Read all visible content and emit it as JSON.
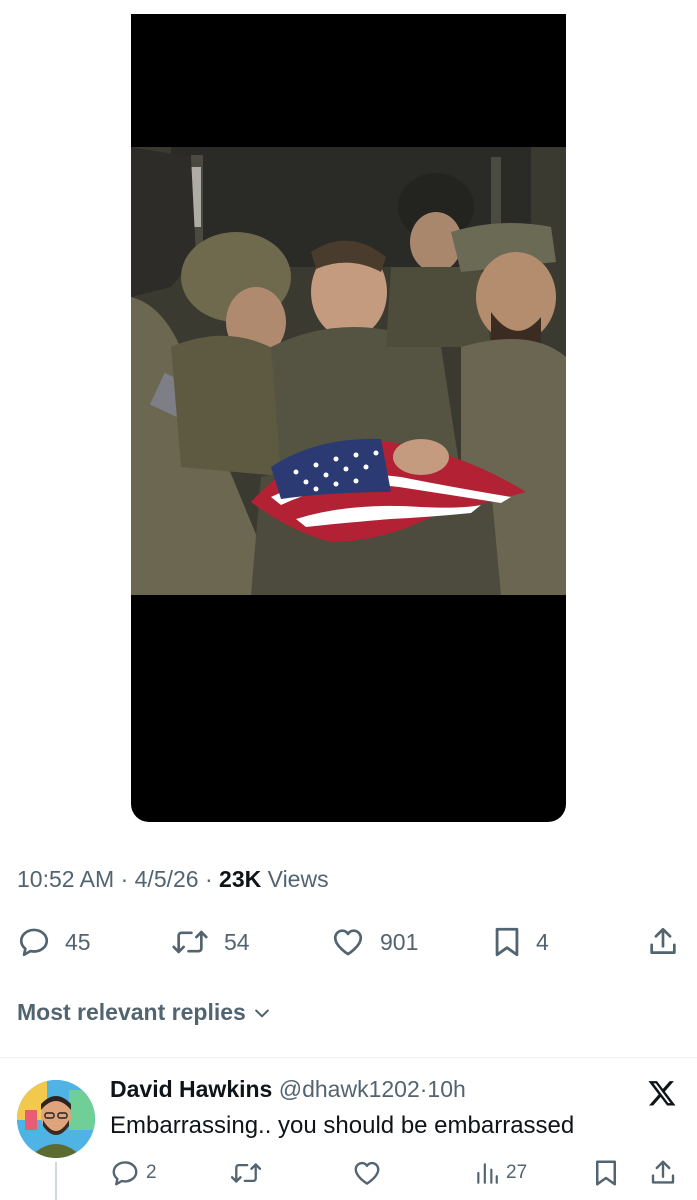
{
  "post": {
    "timestamp": "10:52 AM",
    "date": "4/5/26",
    "separator": "·",
    "views_count": "23K",
    "views_label": "Views"
  },
  "actions": {
    "replies": "45",
    "reposts": "54",
    "likes": "901",
    "bookmarks": "4"
  },
  "replies_sort": {
    "label": "Most relevant replies"
  },
  "reply": {
    "name": "David Hawkins",
    "handle": "@dhawk1202",
    "separator": "·",
    "time": "10h",
    "text": "Embarrassing.. you should be embarrassed",
    "replies": "2",
    "views": "27"
  },
  "icons": {
    "reply": "speech-bubble-icon",
    "repost": "repost-arrows-icon",
    "like": "heart-icon",
    "bookmark": "bookmark-icon",
    "share": "share-upload-icon",
    "chevron": "chevron-down-icon",
    "views": "bar-chart-icon",
    "brand": "x-logo-icon"
  },
  "colors": {
    "text_primary": "#0f1419",
    "text_secondary": "#536471",
    "divider": "#eff3f4"
  }
}
